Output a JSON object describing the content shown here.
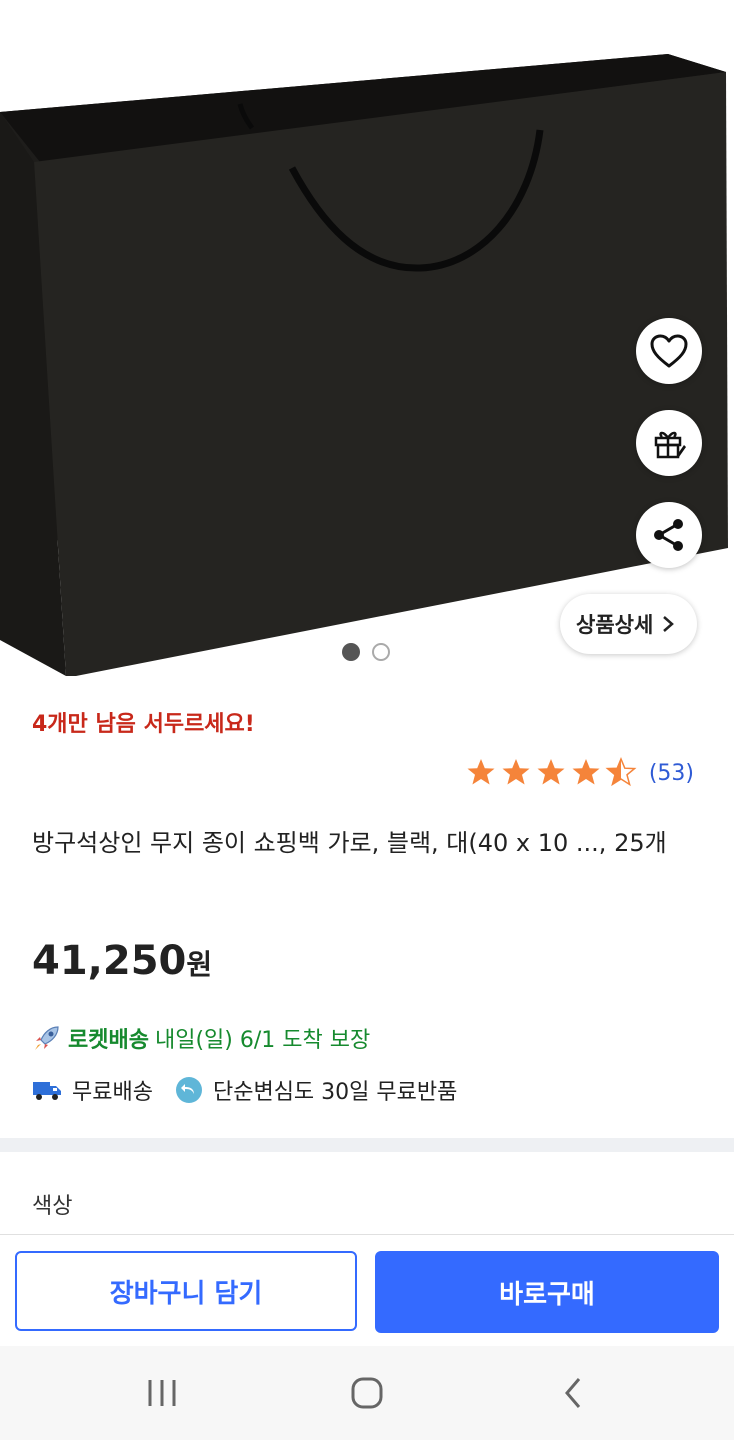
{
  "hero": {
    "detail_button_label": "상품상세",
    "slide_count": 2,
    "active_slide": 1
  },
  "product": {
    "stock_warning": "4개만 남음 서두르세요!",
    "rating_stars": 4.5,
    "review_count": "(53)",
    "title": "방구석상인 무지 종이 쇼핑백 가로, 블랙, 대(40 x 10 ..., 25개",
    "price_amount": "41,250",
    "price_unit": "원",
    "rocket_brand": "로켓배송",
    "rocket_eta": "내일(일) 6/1 도착 보장",
    "free_shipping": "무료배송",
    "free_return": "단순변심도 30일 무료반품"
  },
  "options": {
    "color_label": "색상"
  },
  "actions": {
    "add_to_cart": "장바구니 담기",
    "buy_now": "바로구매"
  },
  "colors": {
    "accent": "#346aff",
    "stock_red": "#c8281a",
    "rocket_green": "#168a2e",
    "star": "#f5843a"
  },
  "icons": [
    "heart-icon",
    "gift-icon",
    "share-icon",
    "chevron-right-icon",
    "star-icon",
    "rocket-icon",
    "truck-icon",
    "return-icon",
    "recents-icon",
    "home-icon",
    "back-icon"
  ]
}
